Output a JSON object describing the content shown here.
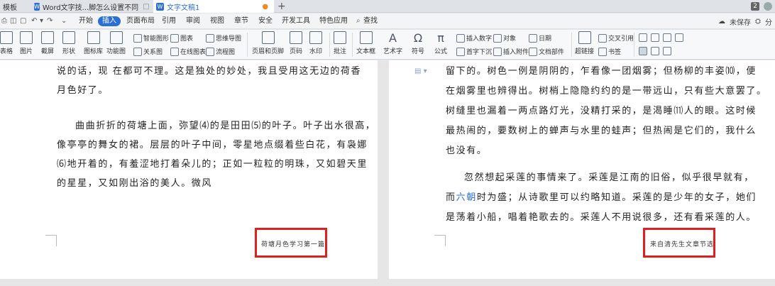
{
  "tabs": {
    "template": "模板",
    "doc1": "Word文字技...脚怎么设置不同",
    "doc2": "文字文稿1",
    "doc_icon": "W",
    "add": "+",
    "page_count": "2"
  },
  "menu": {
    "items": [
      "开始",
      "插入",
      "页面布局",
      "引用",
      "审阅",
      "视图",
      "章节",
      "安全",
      "开发工具",
      "特色应用"
    ],
    "active": "插入",
    "search": "查找",
    "save_status": "未保存",
    "share": "分"
  },
  "ribbon": {
    "table": "表格",
    "picture": "图片",
    "screenshot": "截屏",
    "shape": "形状",
    "icon_lib": "图标库",
    "func_chart": "功能图",
    "smart_shape": "智能图形",
    "chart": "图表",
    "mind_map": "思维导图",
    "relation": "关系图",
    "online_chart": "在线图表",
    "flowchart": "流程图",
    "header_footer": "页眉和页脚",
    "page_number": "页码",
    "watermark": "水印",
    "comment": "批注",
    "textbox": "文本框",
    "wordart": "艺术字",
    "symbol": "符号",
    "formula": "公式",
    "insert_number": "插入数字",
    "object": "对象",
    "date": "日期",
    "drop_cap": "首字下沉",
    "attachment": "插入附件",
    "doc_part": "文档部件",
    "hyperlink": "超链接",
    "cross_ref": "交叉引用",
    "bookmark": "书签"
  },
  "left_page": {
    "lines": [
      "说的话，现 在都可不理。这是独处的妙处，我且受用这无边的荷香",
      "月色好了。",
      "曲曲折折的荷塘上面，弥望⑷的是田田⑸的叶子。叶子出水很高，",
      "像亭亭的舞女的裙。层层的叶子中间，零星地点缀着些白花，有袅娜",
      "⑹地开着的，有羞涩地打着朵儿的；正如一粒粒的明珠，又如碧天里",
      "的星星，又如刚出浴的美人。微风"
    ],
    "footer": "荷塘月色学习第一篇"
  },
  "right_page": {
    "lines": [
      "留下的。树色一例是阴阴的，乍看像一团烟雾；但杨柳的丰姿⑽，便",
      "在烟雾里也辨得出。树梢上隐隐约约的是一带远山，只有些大意罢了。",
      "树缝里也漏着一两点路灯光，没精打采的，是渴睡⑾人的眼。这时候",
      "最热闹的，要数树上的蝉声与水里的蛙声；但热闹是它们的，我什么",
      "也没有。",
      "忽然想起采莲的事情来了。采莲是江南的旧俗，似乎很早就有，",
      "时为盛；从诗歌里可以约略知道。采莲的是少年的女子，她们",
      "是荡着小船，唱着艳歌去的。采莲人不用说很多，还有看采莲的人。"
    ],
    "line7_prefix": "而",
    "line7_link": "六朝",
    "footer": "来自清先生文章节选"
  }
}
